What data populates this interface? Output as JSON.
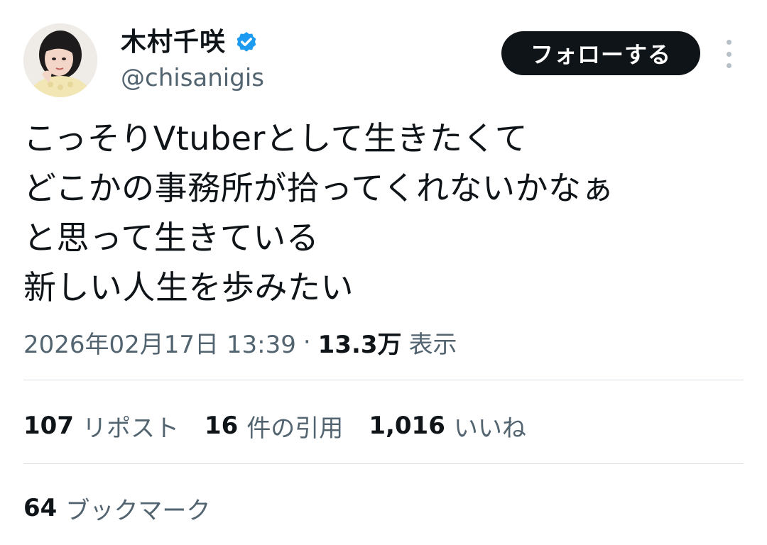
{
  "author": {
    "display_name": "木村千咲",
    "handle": "@chisanigis",
    "verified": true,
    "avatar": "profile-photo"
  },
  "actions": {
    "follow_label": "フォローする",
    "more_icon": "more-vertical-icon"
  },
  "tweet": {
    "lines": [
      "こっそりVtuberとして生きたくて",
      "どこかの事務所が拾ってくれないかなぁ",
      "と思って生きている",
      "新しい人生を歩みたい"
    ]
  },
  "meta": {
    "timestamp": "2026年02月17日 13:39",
    "separator": "·",
    "views_count": "13.3万",
    "views_label": "表示"
  },
  "stats": {
    "reposts_count": "107",
    "reposts_label": "リポスト",
    "quotes_count": "16",
    "quotes_label": "件の引用",
    "likes_count": "1,016",
    "likes_label": "いいね",
    "bookmarks_count": "64",
    "bookmarks_label": "ブックマーク"
  },
  "colors": {
    "text_primary": "#0f1419",
    "text_secondary": "#536471",
    "verified_blue": "#1d9bf0",
    "button_bg": "#0f1419",
    "divider": "#d9dee2"
  }
}
